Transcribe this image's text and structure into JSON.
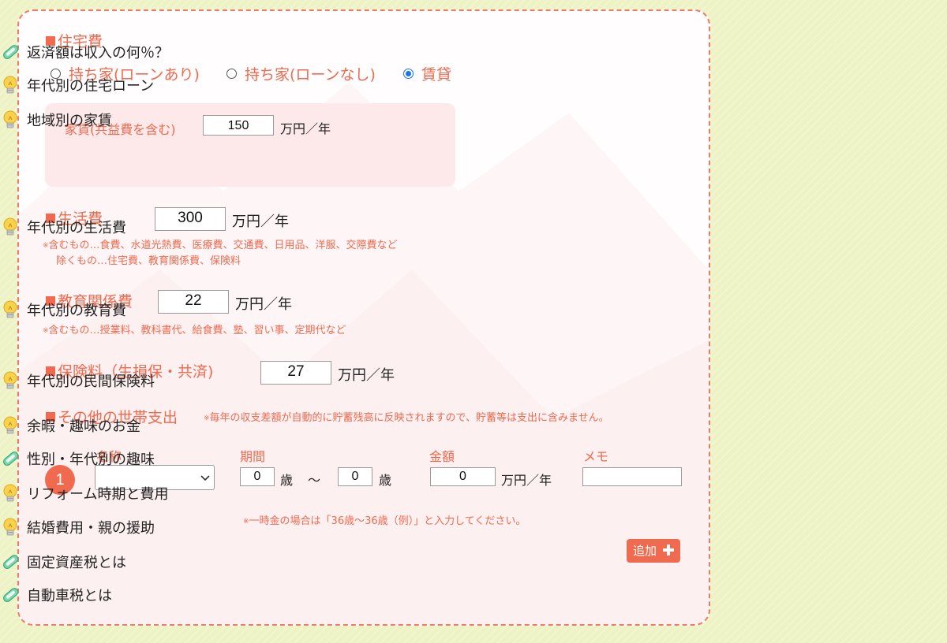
{
  "housing": {
    "title": "住宅費",
    "options": [
      {
        "label": "持ち家(ローンあり)",
        "selected": false
      },
      {
        "label": "持ち家(ローンなし)",
        "selected": false
      },
      {
        "label": "賃貸",
        "selected": true
      }
    ],
    "rent_label": "家賃(共益費を含む)",
    "rent_value": "150",
    "rent_unit": "万円／年"
  },
  "living": {
    "title": "生活費",
    "value": "300",
    "unit": "万円／年",
    "note_mark": "※",
    "note_include": "含むもの…食費、水道光熱費、医療費、交通費、日用品、洋服、交際費など",
    "note_exclude": "除くもの…住宅費、教育関係費、保険料"
  },
  "education": {
    "title": "教育関係費",
    "value": "22",
    "unit": "万円／年",
    "note_mark": "※",
    "note_include": "含むもの…授業料、教科書代、給食費、塾、習い事、定期代など"
  },
  "insurance": {
    "title": "保険料（生損保・共済)",
    "value": "27",
    "unit": "万円／年"
  },
  "other": {
    "title": "その他の世帯支出",
    "note_mark": "※",
    "note": "毎年の収支差額が自動的に貯蓄残高に反映されますので、貯蓄等は支出に含みません。",
    "col_name": "名称",
    "col_period": "期間",
    "col_amount": "金額",
    "col_memo": "メモ",
    "row_number": "1",
    "select_value": "",
    "age_from": "0",
    "age_unit": "歳",
    "tilde": "〜",
    "age_to": "0",
    "amount": "0",
    "amount_unit": "万円／年",
    "memo": "",
    "lump_note_mark": "※",
    "lump_note": "一時金の場合は「36歳〜36歳（例）」と入力してください。",
    "add_label": "追加",
    "add_icon": "plus-icon"
  },
  "sidebar": {
    "items": [
      {
        "label": "返済額は収入の何％？",
        "icon": "paperclip-icon"
      },
      {
        "label": "年代別の住宅ローン",
        "icon": "lightbulb-icon"
      },
      {
        "label": "地域別の家賃",
        "icon": "lightbulb-icon"
      },
      {
        "label": "年代別の生活費",
        "icon": "lightbulb-icon"
      },
      {
        "label": "年代別の教育費",
        "icon": "lightbulb-icon"
      },
      {
        "label": "年代別の民間保険料",
        "icon": "lightbulb-icon"
      },
      {
        "label": "余暇・趣味のお金",
        "icon": "lightbulb-icon"
      },
      {
        "label": "性別・年代別の趣味",
        "icon": "paperclip-icon"
      },
      {
        "label": "リフォーム時期と費用",
        "icon": "lightbulb-icon"
      },
      {
        "label": "結婚費用・親の援助",
        "icon": "lightbulb-icon"
      },
      {
        "label": "固定資産税とは",
        "icon": "paperclip-icon"
      },
      {
        "label": "自動車税とは",
        "icon": "paperclip-icon"
      }
    ]
  },
  "colors": {
    "accent": "#ef6a4f",
    "panel_bg": "#fffdfd",
    "page_bg": "#eef3c6",
    "rent_box_bg": "#fde9e9",
    "radio_selected": "#1a73e8",
    "bulb": "#f3c33b",
    "clip": "#5cc59a"
  }
}
